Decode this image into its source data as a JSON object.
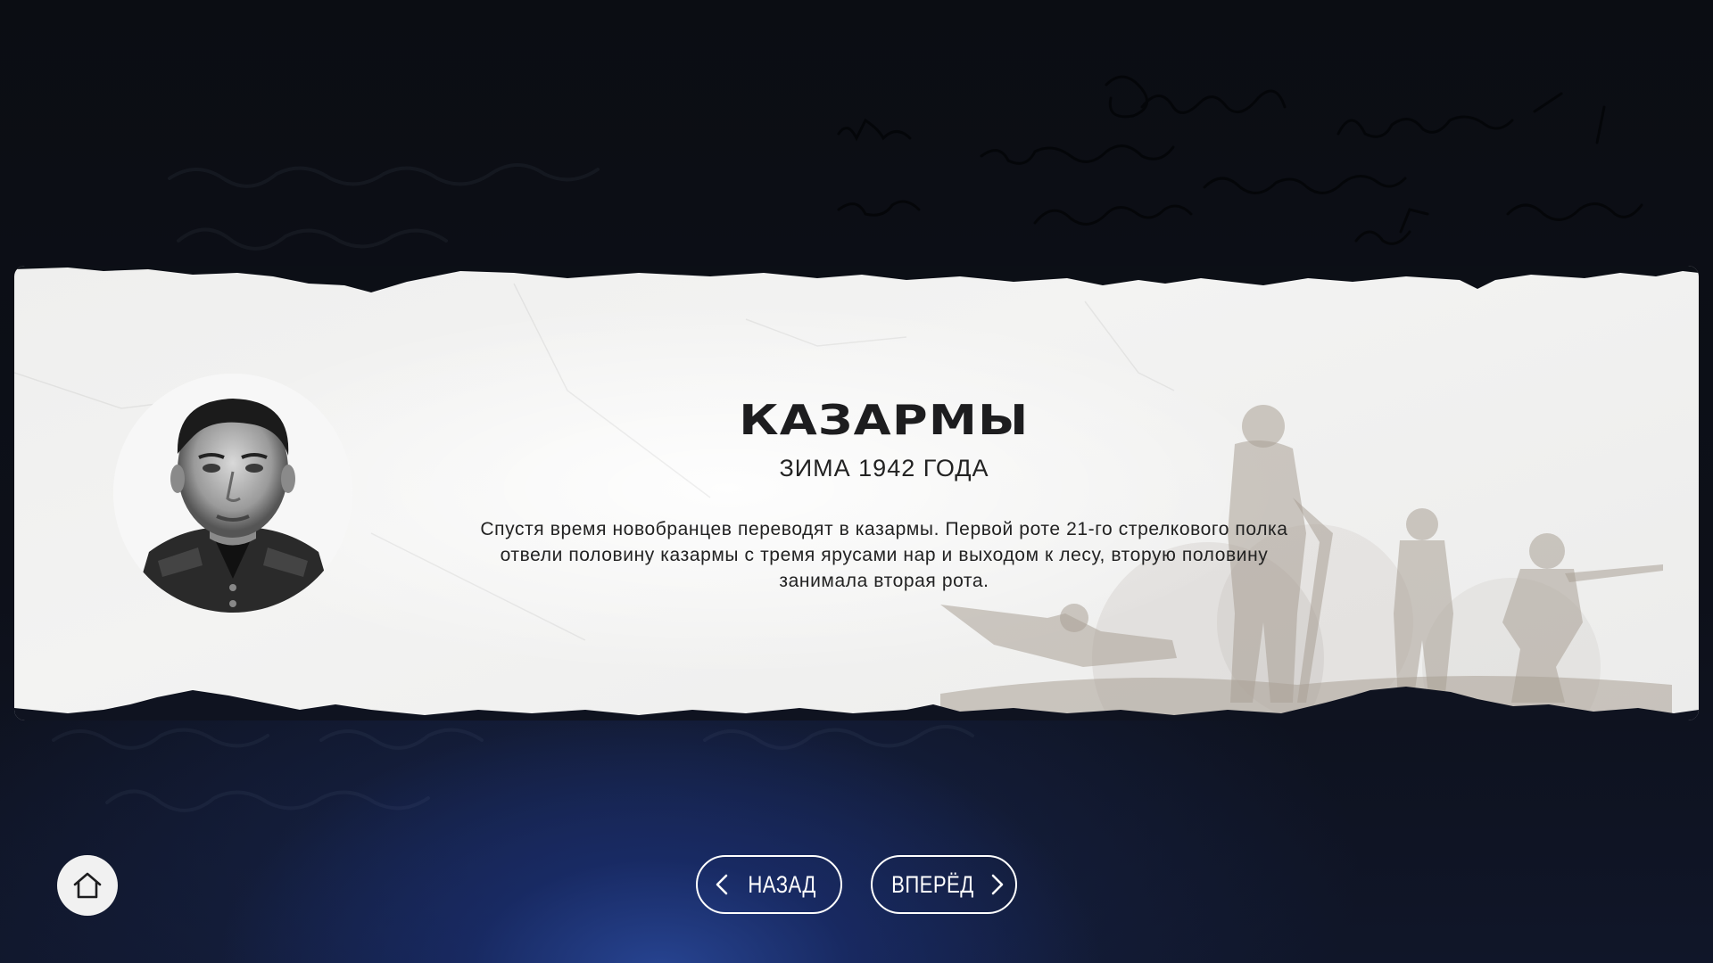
{
  "card": {
    "title": "КАЗАРМЫ",
    "subtitle": "ЗИМА 1942 ГОДА",
    "body": "Спустя время новобранцев переводят в казармы. Первой роте 21-го стрелкового полка отвели половину казармы с тремя ярусами нар и выходом к лесу, вторую половину занимала вторая рота."
  },
  "navigation": {
    "back_label": "НАЗАД",
    "next_label": "ВПЕРЁД",
    "home_icon": "home-icon",
    "back_icon": "chevron-left-icon",
    "next_icon": "chevron-right-icon"
  },
  "colors": {
    "background": "#0c0f16",
    "glow": "#2846a0",
    "paper": "#f0f0ef",
    "text": "#1d1d1f",
    "button_border": "#ffffff"
  }
}
